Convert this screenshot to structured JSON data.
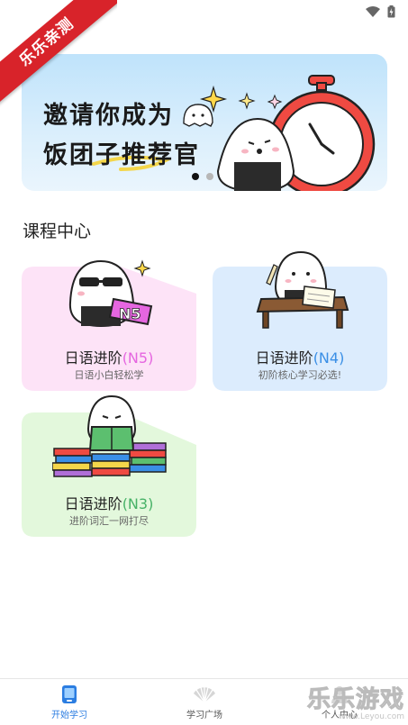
{
  "ribbon": {
    "text": "乐乐亲测"
  },
  "banner": {
    "line1": "邀请你成为",
    "line2": "饭团子推荐官",
    "slide_count": 2,
    "active_slide": 1
  },
  "section": {
    "title": "课程中心"
  },
  "courses": [
    {
      "title": "日语进阶",
      "level": "(N5)",
      "level_color": "#e566e0",
      "subtitle": "日语小白轻松学",
      "bg_color": "#fde3f7"
    },
    {
      "title": "日语进阶",
      "level": "(N4)",
      "level_color": "#3a8fe6",
      "subtitle": "初阶核心学习必选!",
      "bg_color": "#dcecfd"
    },
    {
      "title": "日语进阶",
      "level": "(N3)",
      "level_color": "#47b267",
      "subtitle": "进阶词汇一网打尽",
      "bg_color": "#e3f8dc"
    }
  ],
  "tabs": [
    {
      "label": "开始学习",
      "icon": "tablet-icon",
      "active": true
    },
    {
      "label": "学习广场",
      "icon": "fan-icon",
      "active": false
    },
    {
      "label": "个人中心",
      "icon": "person-icon",
      "active": false
    }
  ],
  "watermark": {
    "brand": "乐乐游戏",
    "url": "www.Leyou.com"
  },
  "colors": {
    "accent": "#2b7de1",
    "ribbon": "#d8232a"
  }
}
